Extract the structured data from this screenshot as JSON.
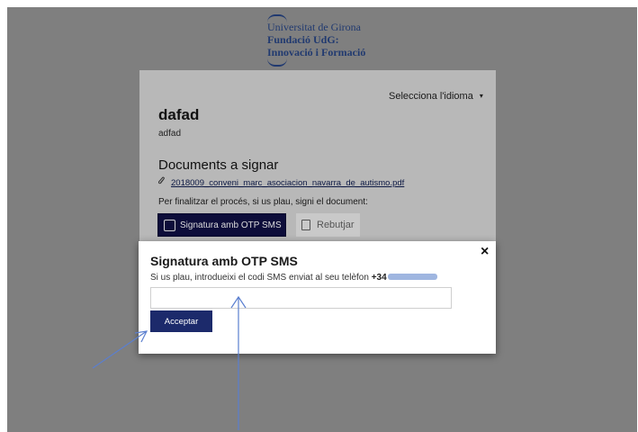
{
  "logo": {
    "line1": "Universitat de Girona",
    "line2": "Fundació UdG:",
    "line3": "Innovació i Formació"
  },
  "language": {
    "label": "Selecciona l'idioma",
    "caret": "▾"
  },
  "document": {
    "title": "dafad",
    "subtitle": "adfad",
    "documents_heading": "Documents a signar",
    "file_link": "2018009_conveni_marc_asociacion_navarra_de_autismo.pdf",
    "finish_hint": "Per finalitzar el procés, si us plau, signi el document:",
    "otp_button": "Signatura amb OTP SMS",
    "reject_button": "Rebutjar"
  },
  "modal": {
    "title": "Signatura amb OTP SMS",
    "close": "×",
    "message": "Si us plau, introdueixi el codi SMS enviat al seu telèfon",
    "phone_prefix": "+34",
    "code_value": "",
    "accept_button": "Acceptar"
  },
  "colors": {
    "backdrop": "#7f7f7f",
    "brand": "#213a70",
    "primary_button": "#1c2a6b",
    "annotation_arrow": "#5b7fcf"
  },
  "icons": {
    "attachment": "paperclip-icon",
    "signature": "signature-icon",
    "trash": "trash-icon",
    "close": "close-icon"
  }
}
